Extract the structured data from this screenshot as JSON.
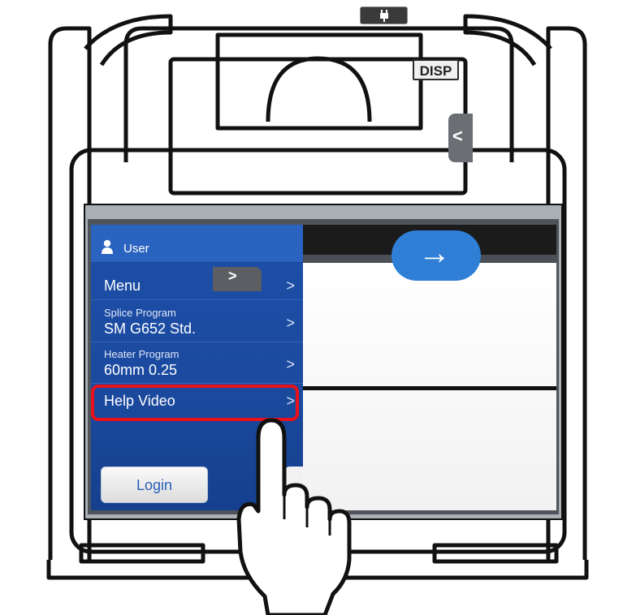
{
  "sidebar": {
    "user_label": "User",
    "items": [
      {
        "label": "Menu",
        "chevron": ">"
      },
      {
        "sublabel": "Splice Program",
        "label": "SM G652 Std.",
        "chevron": ">"
      },
      {
        "sublabel": "Heater Program",
        "label": "60mm 0.25",
        "chevron": ">"
      },
      {
        "label": "Help Video",
        "chevron": ">",
        "highlighted": true
      }
    ],
    "login_label": "Login"
  },
  "display": {
    "disp_label": "DISP",
    "side_tab_chevron": "<",
    "bottom_tab_chevron": ">",
    "next_arrow": "→"
  },
  "colors": {
    "sidebar_blue": "#1d4fa8",
    "highlight_red": "#e8101a",
    "next_button_blue": "#2f7fd6"
  }
}
